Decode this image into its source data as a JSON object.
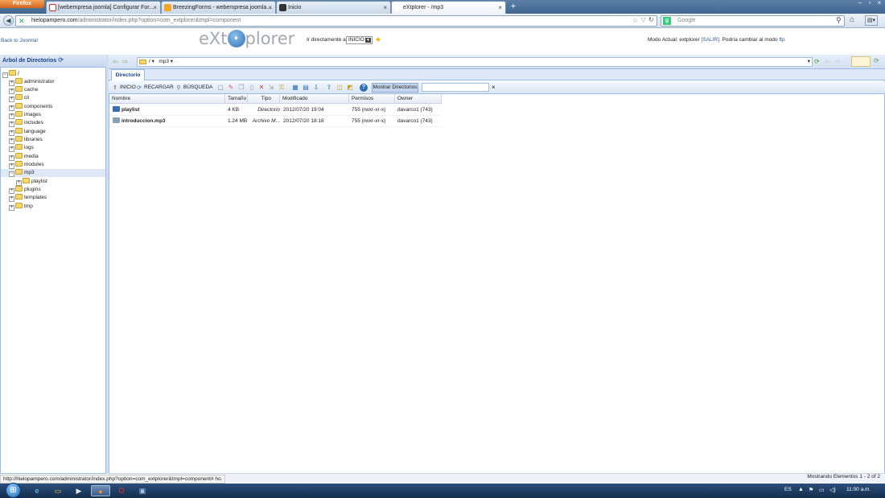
{
  "browser": {
    "menu_button": "Firefox",
    "tabs": [
      {
        "title": "[webempresa joomla] Configurar For...",
        "active": false
      },
      {
        "title": "BreezingForms - webempresa joomla...",
        "active": false
      },
      {
        "title": "Inicio",
        "active": false
      },
      {
        "title": "eXtplorer - /mp3",
        "active": true
      }
    ],
    "url_host": "hielopampero.com",
    "url_path": "/administrator/index.php?option=com_extplorer&tmpl=component",
    "search_placeholder": "Google"
  },
  "header": {
    "back_link": "Back to Joomla!",
    "logo_left": "eXt",
    "logo_right": "plorer",
    "goto_label": "Ir directamente a:",
    "goto_value": "INICIO",
    "mode_prefix": "Modo Actual: extplorer",
    "mode_exit": "[SALIR].",
    "mode_middle": "Podría cambiar al modo",
    "mode_link": "ftp"
  },
  "tree": {
    "title": "Árbol de Directorios",
    "root": "/",
    "items": [
      "administrator",
      "cache",
      "cli",
      "components",
      "images",
      "includes",
      "language",
      "libraries",
      "logs",
      "media",
      "modules",
      "mp3",
      "playlist",
      "plugins",
      "templates",
      "tmp"
    ]
  },
  "location": {
    "root": "/",
    "folder": "mp3"
  },
  "main_tab": "Directorio",
  "toolbar": {
    "home": "INICIO",
    "reload": "RECARGAR",
    "search": "BÚSQUEDA",
    "show_dirs": "Mostrar Directorios"
  },
  "grid": {
    "headers": [
      "Nombre",
      "Tamaño",
      "Tipo",
      "Modificado",
      "Permisos",
      "Owner"
    ],
    "rows": [
      [
        "playlist",
        "4 KB",
        "Directorio",
        "2012/07/20 19:04",
        "755 (rwxr-xr-x)",
        "davarco1 (743)"
      ],
      [
        "introduccion.mp3",
        "1.24 MB",
        "Archivo M...",
        "2012/07/20 18:18",
        "755 (rwxr-xr-x)",
        "davarco1 (743)"
      ]
    ]
  },
  "status": {
    "right": "Mostrando Elementos 1 - 2 of 2",
    "link_tooltip": "http://hielopampero.com/administrator/index.php?option=com_extplorer&tmpl=component#",
    "link_tail": "ho."
  },
  "taskbar": {
    "lang": "ES",
    "clock": "11:00 a.m."
  }
}
